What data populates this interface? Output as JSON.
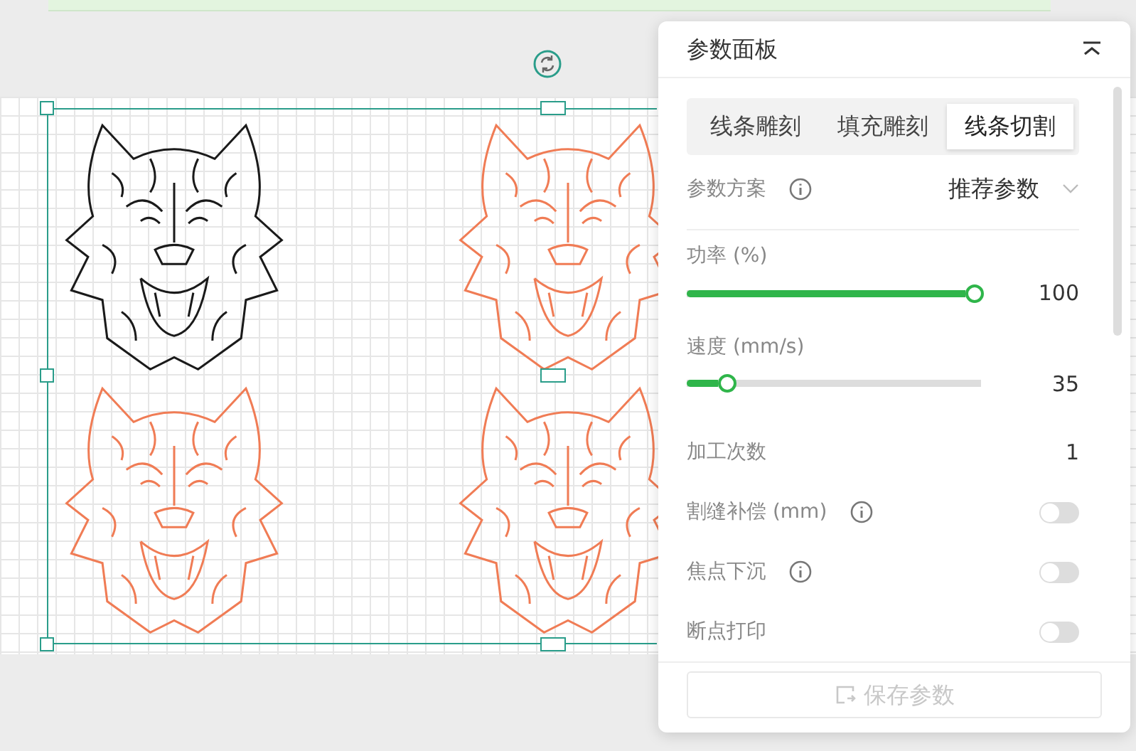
{
  "canvas": {
    "designs": [
      {
        "color": "#1a1a1a"
      },
      {
        "color": "#f07c55"
      },
      {
        "color": "#f07c55"
      },
      {
        "color": "#f07c55"
      }
    ]
  },
  "panel": {
    "title": "参数面板",
    "tabs": [
      {
        "label": "线条雕刻",
        "selected": false
      },
      {
        "label": "填充雕刻",
        "selected": false
      },
      {
        "label": "线条切割",
        "selected": true
      }
    ],
    "preset": {
      "label": "参数方案",
      "value": "推荐参数"
    },
    "sliders": [
      {
        "label": "功率 (%)",
        "level": 0.98,
        "reading": "100"
      },
      {
        "label": "速度 (mm/s)",
        "level": 0.14,
        "reading": "35"
      }
    ],
    "rows": [
      {
        "kind": "number",
        "label": "加工次数",
        "value": "1"
      },
      {
        "kind": "toggle",
        "label": "割缝补偿 (mm)",
        "info": true,
        "on": false
      },
      {
        "kind": "toggle",
        "label": "焦点下沉",
        "info": true,
        "on": false
      },
      {
        "kind": "toggle",
        "label": "断点打印",
        "info": false,
        "on": false
      }
    ],
    "save_button": {
      "label": "保存参数",
      "disabled": true
    }
  }
}
